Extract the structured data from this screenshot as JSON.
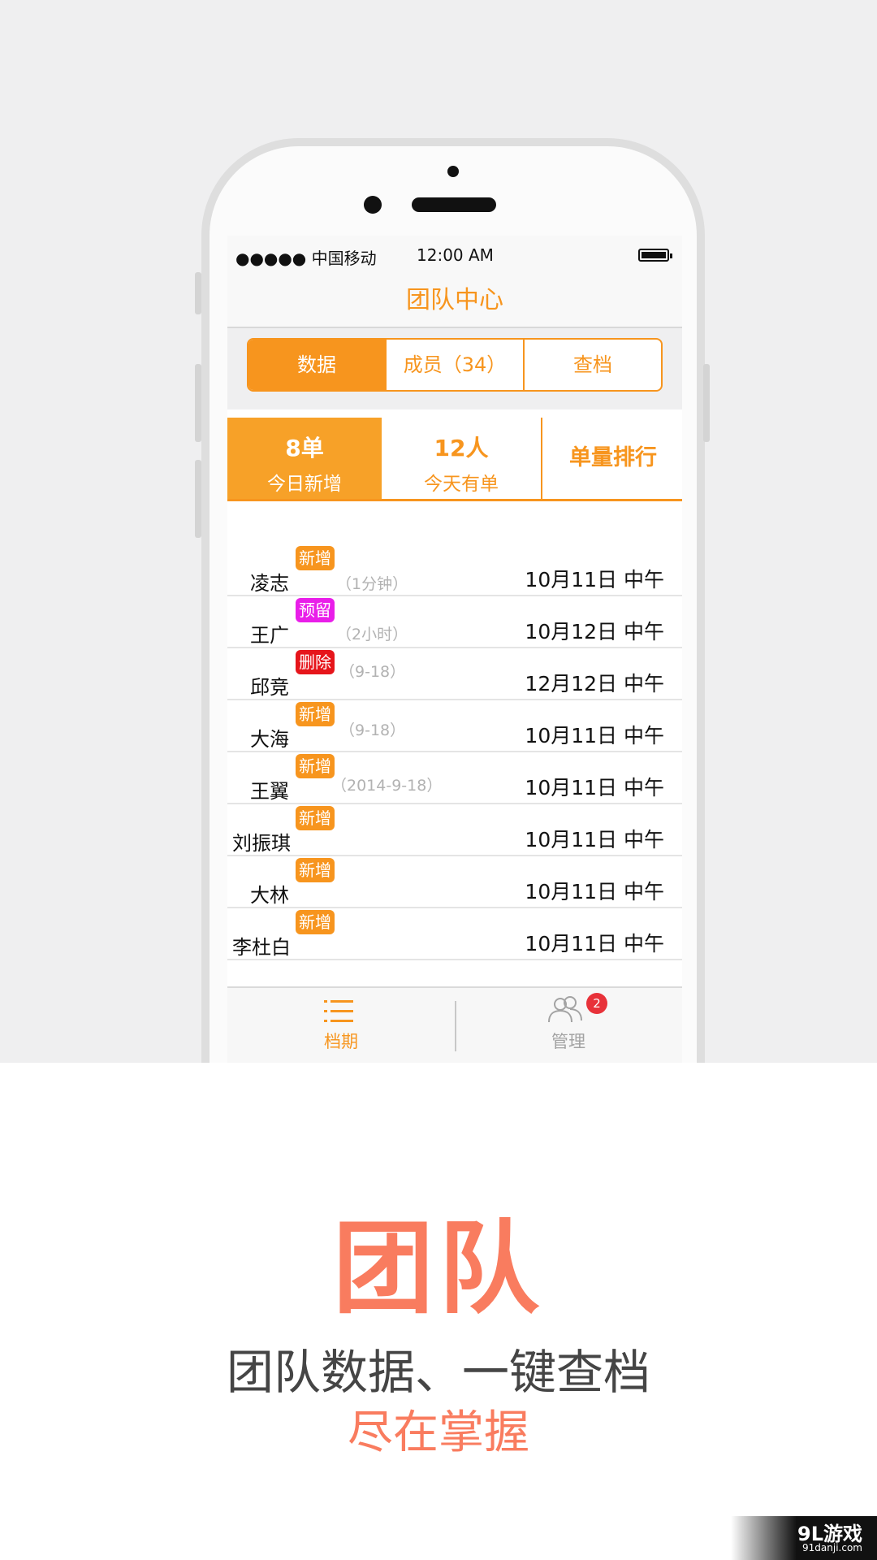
{
  "status_bar": {
    "carrier": "●●●●● 中国移动",
    "time": "12:00 AM"
  },
  "nav": {
    "title": "团队中心"
  },
  "segments": [
    {
      "label": "数据",
      "active": true
    },
    {
      "label": "成员（34）",
      "active": false
    },
    {
      "label": "查档",
      "active": false
    }
  ],
  "stats": {
    "today_new": {
      "value": "8单",
      "label": "今日新增"
    },
    "today_orders": {
      "value": "12人",
      "label": "今天有单"
    },
    "ranking": {
      "label": "单量排行"
    }
  },
  "members": [
    {
      "name": "凌志",
      "badge": "新增",
      "note": "（1分钟）",
      "date": "10月11日 中午"
    },
    {
      "name": "王广",
      "badge": "预留",
      "note": "（2小时）",
      "date": "10月12日 中午"
    },
    {
      "name": "邱竞",
      "badge": "删除",
      "note": "（9-18）",
      "date": "12月12日 中午"
    },
    {
      "name": "大海",
      "badge": "新增",
      "note": "（9-18）",
      "date": "10月11日 中午"
    },
    {
      "name": "王翼",
      "badge": "新增",
      "note": "（2014-9-18）",
      "date": "10月11日 中午"
    },
    {
      "name": "刘振琪",
      "badge": "新增",
      "note": "",
      "date": "10月11日 中午"
    },
    {
      "name": "大林",
      "badge": "新增",
      "note": "",
      "date": "10月11日 中午"
    },
    {
      "name": "李杜白",
      "badge": "新增",
      "note": "",
      "date": "10月11日 中午"
    }
  ],
  "tabbar": {
    "archive": {
      "label": "档期",
      "icon": "list-icon"
    },
    "manage": {
      "label": "管理",
      "icon": "users-icon",
      "badge": "2"
    }
  },
  "promo": {
    "headline": "团队",
    "line1": "团队数据、一键查档",
    "line2": "尽在掌握"
  },
  "watermark": {
    "logo": "9L游戏",
    "url": "91danji.com"
  },
  "colors": {
    "accent": "#f7951e",
    "promo": "#f97c5f",
    "new": "#f7951e",
    "reserve": "#e91ee9",
    "delete": "#e6151b"
  }
}
